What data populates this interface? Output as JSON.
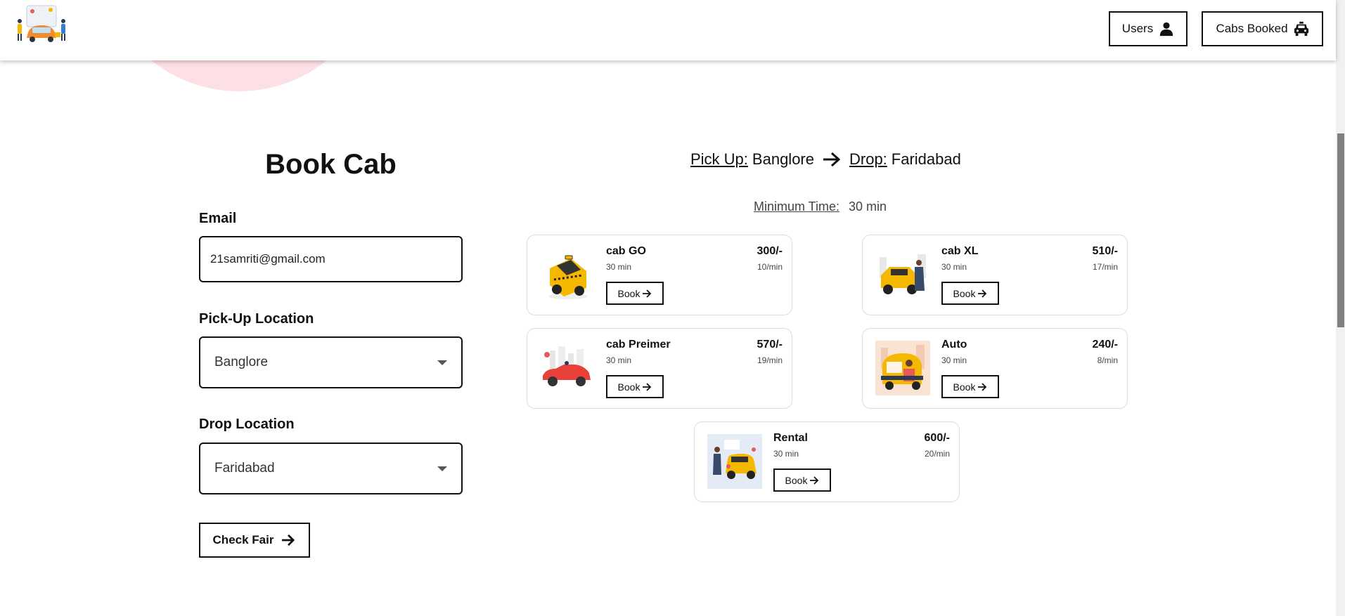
{
  "header": {
    "users_label": "Users",
    "cabs_booked_label": "Cabs Booked"
  },
  "form": {
    "title": "Book Cab",
    "email_label": "Email",
    "email_value": "21samriti@gmail.com",
    "pickup_label": "Pick-Up Location",
    "pickup_value": "Banglore",
    "drop_label": "Drop Location",
    "drop_value": "Faridabad",
    "check_label": "Check Fair"
  },
  "route": {
    "pickup_label": "Pick Up:",
    "pickup_value": "Banglore",
    "drop_label": "Drop:",
    "drop_value": "Faridabad",
    "min_time_label": "Minimum Time:",
    "min_time_value": "30 min"
  },
  "cabs": [
    {
      "name": "cab GO",
      "time": "30 min",
      "price": "300/-",
      "rate": "10/min",
      "book": "Book",
      "icon": "yellow-taxi-icon"
    },
    {
      "name": "cab XL",
      "time": "30 min",
      "price": "510/-",
      "rate": "17/min",
      "book": "Book",
      "icon": "suv-icon"
    },
    {
      "name": "cab Preimer",
      "time": "30 min",
      "price": "570/-",
      "rate": "19/min",
      "book": "Book",
      "icon": "red-convertible-icon"
    },
    {
      "name": "Auto",
      "time": "30 min",
      "price": "240/-",
      "rate": "8/min",
      "book": "Book",
      "icon": "auto-rickshaw-icon"
    },
    {
      "name": "Rental",
      "time": "30 min",
      "price": "600/-",
      "rate": "20/min",
      "book": "Book",
      "icon": "rental-taxi-icon"
    }
  ],
  "colors": {
    "accent_pink": "#fde0e6",
    "taxi_yellow": "#f5b800",
    "border": "#111111"
  }
}
